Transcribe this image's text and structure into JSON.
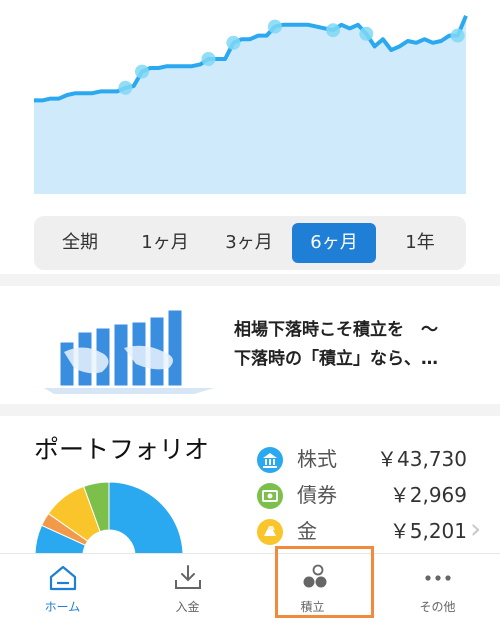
{
  "chart_data": {
    "type": "area",
    "title": "",
    "colors": {
      "line": "#2aa8f0",
      "fill": "#cfeafb",
      "dot": "#7fd8f5"
    },
    "ylim": [
      0,
      100
    ],
    "series": [
      {
        "values": [
          52,
          52,
          53,
          53,
          55,
          56,
          56,
          56,
          57,
          57,
          57,
          59,
          60,
          68,
          70,
          70,
          71,
          71,
          71,
          71,
          72,
          75,
          75,
          75,
          84,
          86,
          86,
          88,
          88,
          93,
          94,
          94,
          94,
          94,
          93,
          92,
          91,
          94,
          92,
          94,
          89,
          82,
          86,
          80,
          82,
          85,
          84,
          86,
          84,
          85,
          88,
          88,
          99
        ]
      }
    ],
    "markers": [
      11,
      13,
      21,
      24,
      29,
      36,
      40,
      51
    ]
  },
  "range_tabs": [
    {
      "label": "全期",
      "active": false
    },
    {
      "label": "1ヶ月",
      "active": false
    },
    {
      "label": "3ヶ月",
      "active": false
    },
    {
      "label": "6ヶ月",
      "active": true
    },
    {
      "label": "1年",
      "active": false
    }
  ],
  "banner": {
    "line1": "相場下落時こそ積立を　～",
    "line2": "下落時の「積立」なら、…"
  },
  "portfolio": {
    "title": "ポートフォリオ",
    "items": [
      {
        "name": "株式",
        "value": "￥43,730",
        "color": "#2aa8f0",
        "icon": "bank-icon"
      },
      {
        "name": "債券",
        "value": "￥2,969",
        "color": "#7cc04b",
        "icon": "bond-icon"
      },
      {
        "name": "金",
        "value": "￥5,201",
        "color": "#f9c52a",
        "icon": "gold-icon"
      }
    ]
  },
  "nav": [
    {
      "label": "ホーム",
      "icon": "home-icon",
      "active": true
    },
    {
      "label": "入金",
      "icon": "deposit-icon",
      "active": false
    },
    {
      "label": "積立",
      "icon": "savings-icon",
      "active": false
    },
    {
      "label": "その他",
      "icon": "more-icon",
      "active": false
    }
  ]
}
